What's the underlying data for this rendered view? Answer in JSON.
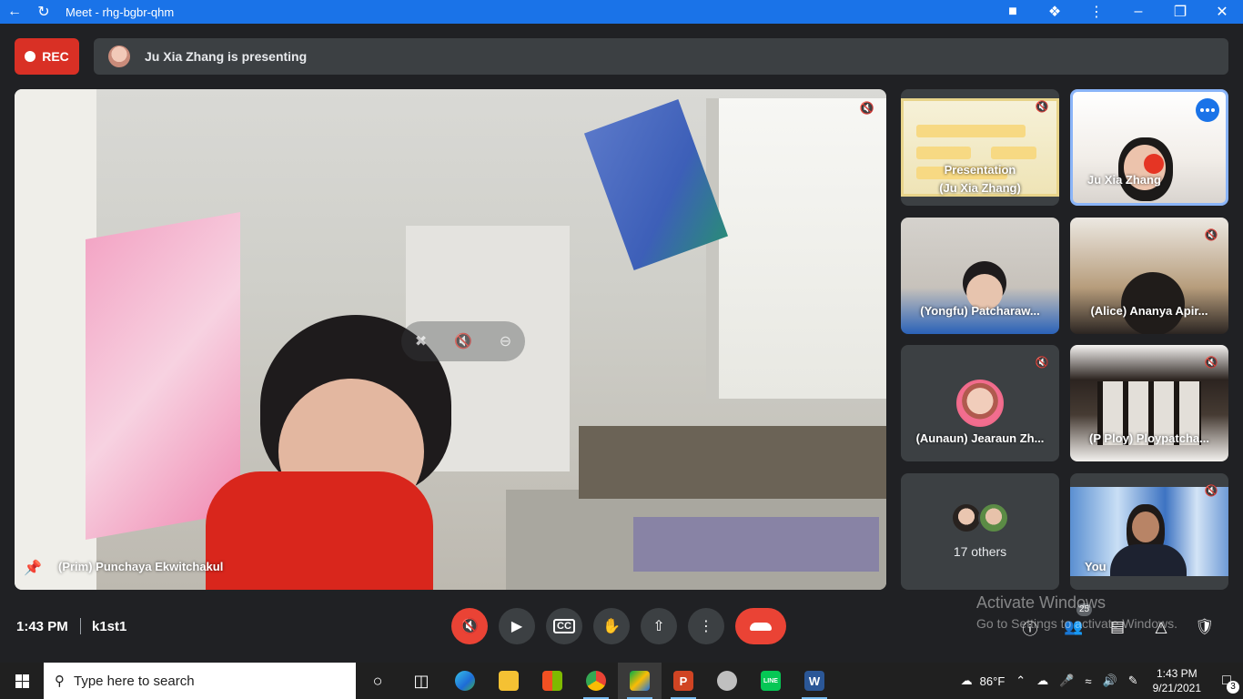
{
  "window": {
    "title": "Meet - rhg-bgbr-qhm"
  },
  "topbar": {
    "rec_label": "REC",
    "presenting_text": "Ju Xia Zhang is presenting"
  },
  "main_tile": {
    "name": "(Prim) Punchaya Ekwitchakul"
  },
  "tiles": [
    {
      "label": "Presentation (Ju Xia Zhang)",
      "line1": "Presentation",
      "line2": "(Ju Xia Zhang)",
      "muted": true
    },
    {
      "label": "Ju Xia Zhang",
      "speaking": true
    },
    {
      "label": "(Yongfu) Patcharaw...",
      "muted": false
    },
    {
      "label": "(Alice) Ananya Apir...",
      "muted": true
    },
    {
      "label": "(Aunaun) Jearaun Zh...",
      "muted": true
    },
    {
      "label": "(P Ploy) Ploypatcha...",
      "muted": true
    },
    {
      "label": "17 others"
    },
    {
      "label": "You",
      "muted": true
    }
  ],
  "bottom": {
    "time": "1:43 PM",
    "meeting_code": "k1st1",
    "participants_count": "25",
    "watermark_title": "Activate Windows",
    "watermark_sub": "Go to Settings to activate Windows."
  },
  "taskbar": {
    "search_placeholder": "Type here to search",
    "weather": "86°F",
    "time": "1:43 PM",
    "date": "9/21/2021",
    "notifications": "3"
  },
  "colors": {
    "accent": "#1a73e8",
    "danger": "#ea4335",
    "surface": "#3c4043",
    "background": "#202124"
  }
}
